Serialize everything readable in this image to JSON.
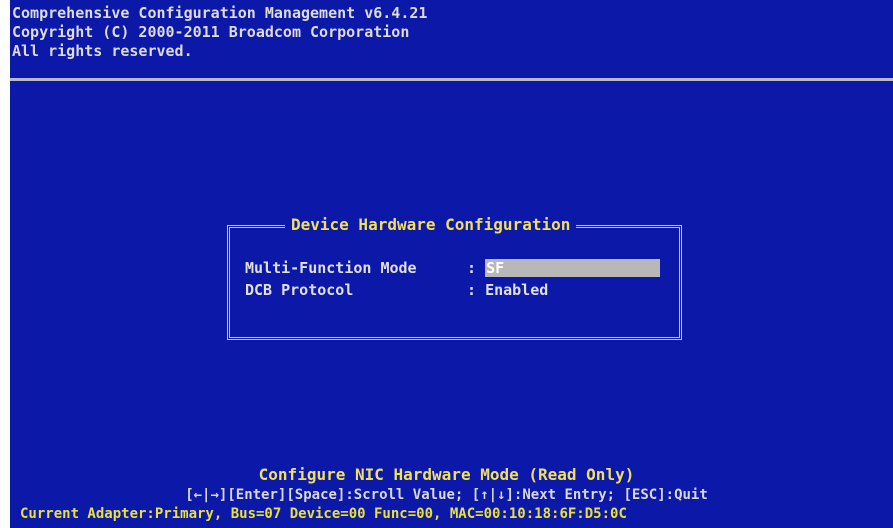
{
  "header": {
    "line1": "Comprehensive Configuration Management v6.4.21",
    "line2": "Copyright (C) 2000-2011 Broadcom Corporation",
    "line3": "All rights reserved."
  },
  "dialog": {
    "title": "Device Hardware Configuration",
    "fields": [
      {
        "label": "Multi-Function Mode",
        "separator": ": ",
        "value": "SF",
        "selected": true
      },
      {
        "label": "DCB Protocol",
        "separator": ": ",
        "value": "Enabled",
        "selected": false
      }
    ]
  },
  "footer": {
    "title": "Configure NIC Hardware Mode (Read Only)",
    "keys": "[←|→][Enter][Space]:Scroll Value; [↑|↓]:Next Entry; [ESC]:Quit",
    "adapter": "Current Adapter:Primary, Bus=07 Device=00 Func=00, MAC=00:10:18:6F:D5:0C"
  },
  "colors": {
    "background": "#0c18a8",
    "highlight_text": "#f0e060",
    "selection_bar": "#b8b8b8"
  }
}
